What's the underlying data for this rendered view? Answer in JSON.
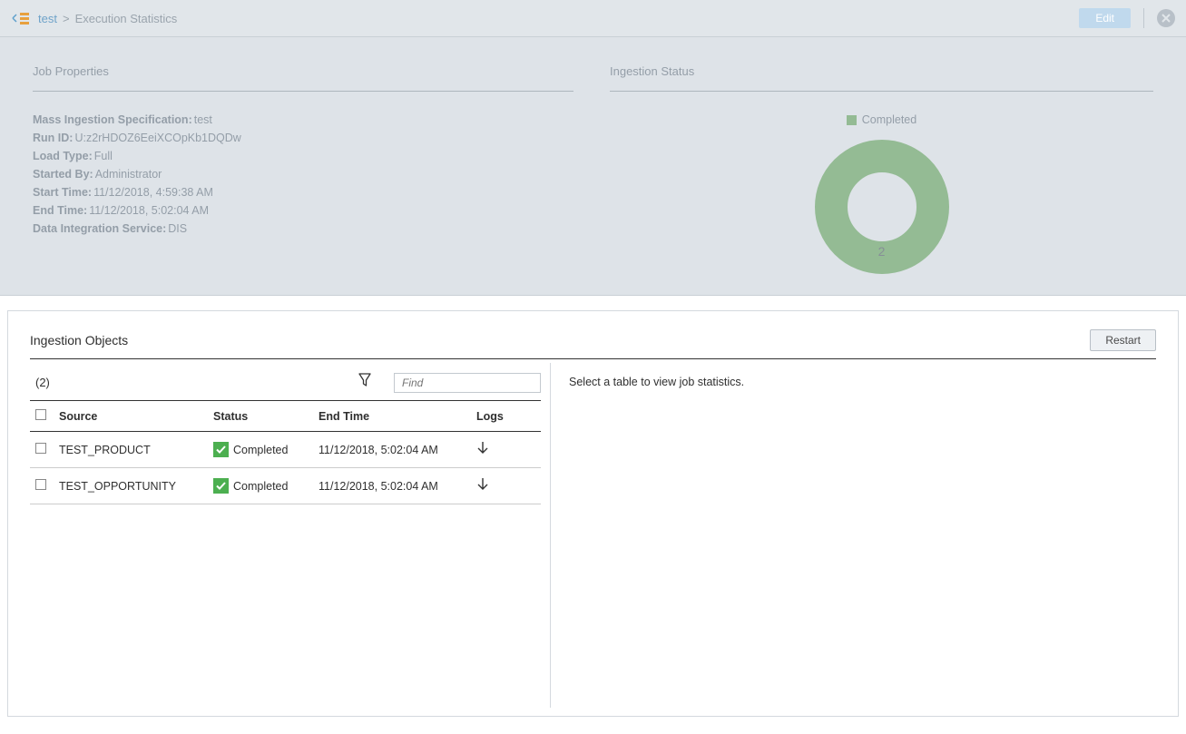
{
  "breadcrumb": {
    "link": "test",
    "current": "Execution Statistics"
  },
  "header": {
    "edit": "Edit"
  },
  "jobProps": {
    "title": "Job Properties",
    "spec_label": "Mass Ingestion Specification:",
    "spec_val": "test",
    "run_label": "Run ID:",
    "run_val": "U:z2rHDOZ6EeiXCOpKb1DQDw",
    "load_label": "Load Type:",
    "load_val": "Full",
    "started_label": "Started By:",
    "started_val": "Administrator",
    "start_label": "Start Time:",
    "start_val": "11/12/2018, 4:59:38 AM",
    "end_label": "End Time:",
    "end_val": "11/12/2018, 5:02:04 AM",
    "dis_label": "Data Integration Service:",
    "dis_val": "DIS"
  },
  "ingestionStatus": {
    "title": "Ingestion Status",
    "legend": "Completed",
    "value": "2"
  },
  "objects": {
    "title": "Ingestion Objects",
    "restart": "Restart",
    "count": "(2)",
    "find_placeholder": "Find",
    "hint": "Select a table to view job statistics.",
    "cols": {
      "source": "Source",
      "status": "Status",
      "end": "End Time",
      "logs": "Logs"
    },
    "rows": [
      {
        "source": "TEST_PRODUCT",
        "status": "Completed",
        "end": "11/12/2018, 5:02:04 AM"
      },
      {
        "source": "TEST_OPPORTUNITY",
        "status": "Completed",
        "end": "11/12/2018, 5:02:04 AM"
      }
    ]
  },
  "chart_data": {
    "type": "pie",
    "title": "Ingestion Status",
    "categories": [
      "Completed"
    ],
    "values": [
      2
    ],
    "series": [
      {
        "name": "Completed",
        "values": [
          2
        ]
      }
    ]
  }
}
